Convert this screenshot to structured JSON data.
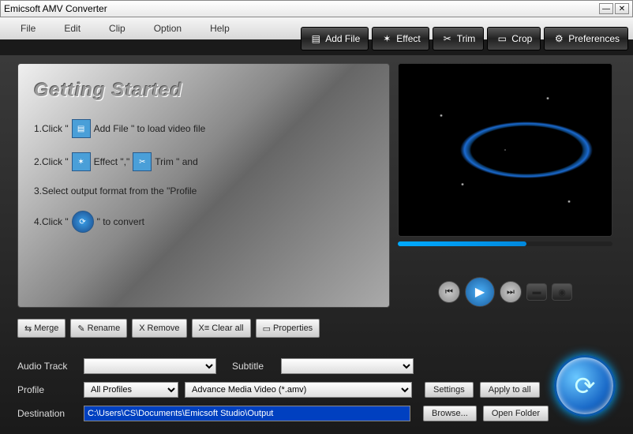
{
  "title": "Emicsoft AMV Converter",
  "menu": [
    "File",
    "Edit",
    "Clip",
    "Option",
    "Help"
  ],
  "toolbar": [
    {
      "icon": "film",
      "label": "Add File"
    },
    {
      "icon": "sparkle",
      "label": "Effect"
    },
    {
      "icon": "scissors",
      "label": "Trim"
    },
    {
      "icon": "crop",
      "label": "Crop"
    },
    {
      "icon": "gear",
      "label": "Preferences"
    }
  ],
  "getting_started": {
    "title": "Getting Started",
    "steps": [
      {
        "prefix": "1.Click \"",
        "icon": "film",
        "suffix": "Add File \"  to load video file"
      },
      {
        "prefix": "2.Click \"",
        "icon": "sparkle",
        "mid": "Effect \",\"",
        "icon2": "scissors",
        "suffix": "Trim \"  and"
      },
      {
        "text": "3.Select output format from the \"Profile"
      },
      {
        "prefix": "4.Click \"",
        "icon": "convert",
        "suffix": "\"  to convert"
      }
    ]
  },
  "file_buttons": [
    {
      "icon": "merge",
      "label": "Merge"
    },
    {
      "icon": "pencil",
      "label": "Rename"
    },
    {
      "icon": "x",
      "label": "Remove"
    },
    {
      "icon": "clear",
      "label": "Clear all"
    },
    {
      "icon": "props",
      "label": "Properties"
    }
  ],
  "form": {
    "audio_track_label": "Audio Track",
    "audio_track_value": "",
    "subtitle_label": "Subtitle",
    "subtitle_value": "",
    "profile_label": "Profile",
    "profile_category": "All Profiles",
    "profile_value": "Advance Media Video (*.amv)",
    "settings_btn": "Settings",
    "apply_btn": "Apply to all",
    "destination_label": "Destination",
    "destination_value": "C:\\Users\\CS\\Documents\\Emicsoft Studio\\Output",
    "browse_btn": "Browse...",
    "open_folder_btn": "Open Folder"
  },
  "icons": {
    "film": "▤",
    "sparkle": "✶",
    "scissors": "✂",
    "crop": "▭",
    "gear": "⚙",
    "merge": "⇆",
    "pencil": "✎",
    "x": "X",
    "clear": "X≡",
    "props": "▭",
    "convert": "⟳",
    "prev": "⏮",
    "play": "▶",
    "next": "⏭",
    "folder": "▬",
    "camera": "◉"
  }
}
